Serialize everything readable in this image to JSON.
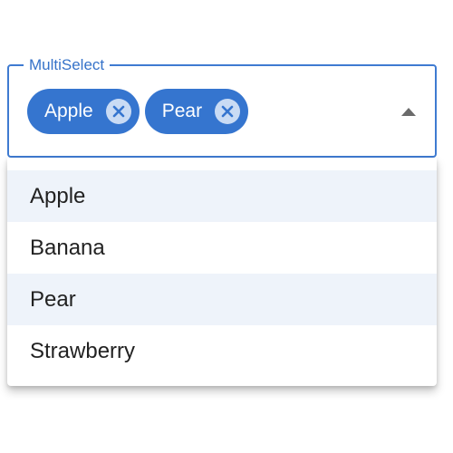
{
  "field": {
    "label": "MultiSelect",
    "selected_chips": [
      {
        "label": "Apple",
        "remove_icon": "close-circle-icon"
      },
      {
        "label": "Pear",
        "remove_icon": "close-circle-icon"
      }
    ],
    "toggle_icon": "caret-up-icon"
  },
  "dropdown": {
    "options": [
      {
        "label": "Apple",
        "selected": true
      },
      {
        "label": "Banana",
        "selected": false
      },
      {
        "label": "Pear",
        "selected": true
      },
      {
        "label": "Strawberry",
        "selected": false
      }
    ]
  },
  "colors": {
    "accent": "#3575cf",
    "chip_remove_bg": "#c9dbf4",
    "selected_option_bg": "#eef3fa",
    "label": "#3572c9",
    "option_text": "#222222"
  }
}
